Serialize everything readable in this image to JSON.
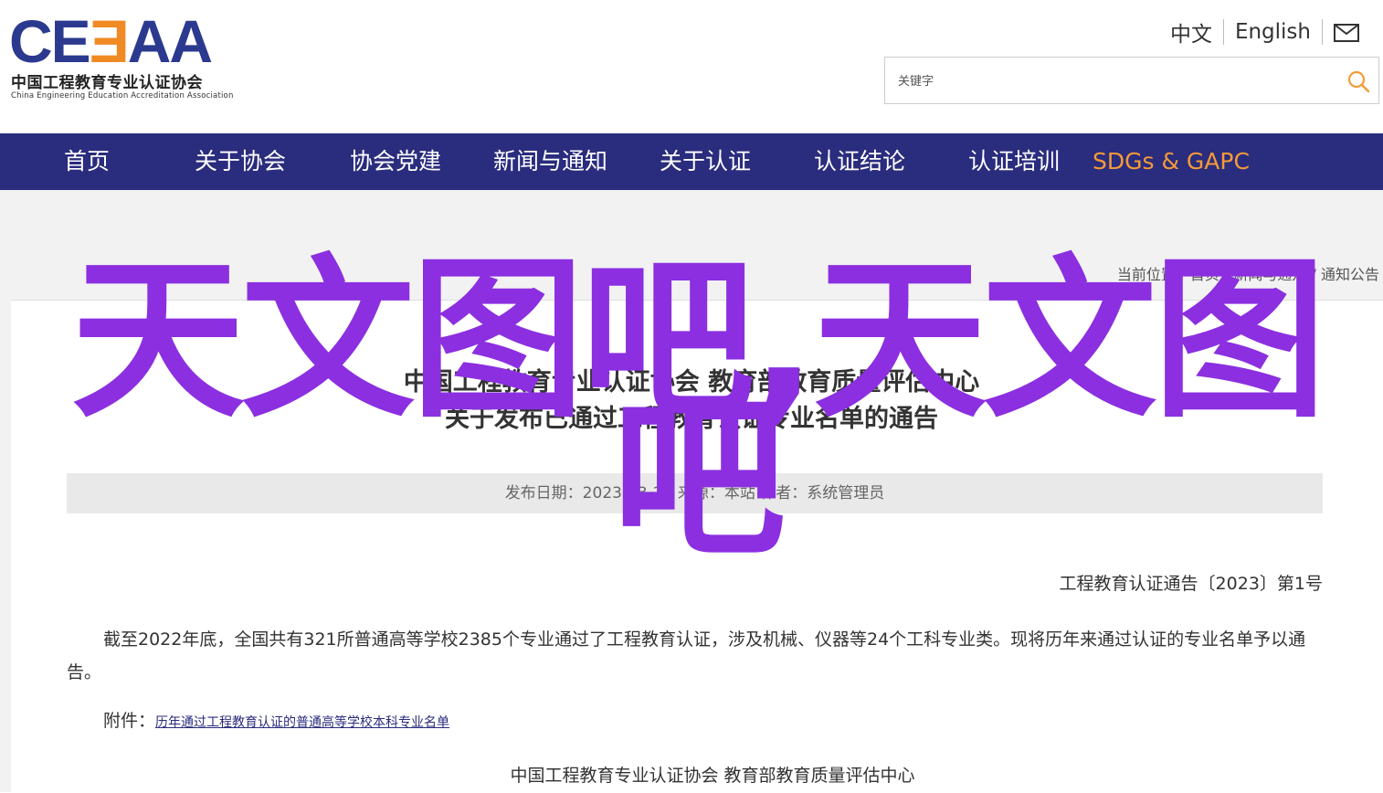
{
  "header": {
    "logo_mark_left": "CE",
    "logo_mark_mid": "Ǝ",
    "logo_mark_right": "AA",
    "logo_cn": "中国工程教育专业认证协会",
    "logo_en": "China Engineering Education Accreditation Association",
    "lang_cn": "中文",
    "lang_en": "English",
    "search_placeholder": "关键字"
  },
  "nav": {
    "items": [
      "首页",
      "关于协会",
      "协会党建",
      "新闻与通知",
      "关于认证",
      "认证结论",
      "认证培训",
      "SDGs & GAPC"
    ]
  },
  "breadcrumb": {
    "label": "当前位置：",
    "home": "首页",
    "sep": " / ",
    "news": "新闻与通知",
    "notices": "通知公告"
  },
  "article": {
    "title_line1": "中国工程教育专业认证协会 教育部教育质量评估中心",
    "title_line2": "关于发布已通过工程教育认证专业名单的通告",
    "meta": "发布日期：2023-03-28    来源：本站    作者：系统管理员",
    "notice_no": "工程教育认证通告〔2023〕第1号",
    "paragraph": "截至2022年底，全国共有321所普通高等学校2385个专业通过了工程教育认证，涉及机械、仪器等24个工科专业类。现将历年来通过认证的专业名单予以通告。",
    "attachment_label": "附件：",
    "attachment_link": "历年通过工程教育认证的普通高等学校本科专业名单",
    "signature": "中国工程教育专业认证协会    教育部教育质量评估中心"
  },
  "overlay": {
    "line1": "天文图吧,天文图",
    "line2": "吧"
  },
  "colors": {
    "nav_bg": "#2a2c7d",
    "accent_orange": "#f59a38",
    "overlay_purple": "#8b2fe0",
    "logo_blue": "#2b3a8f"
  }
}
